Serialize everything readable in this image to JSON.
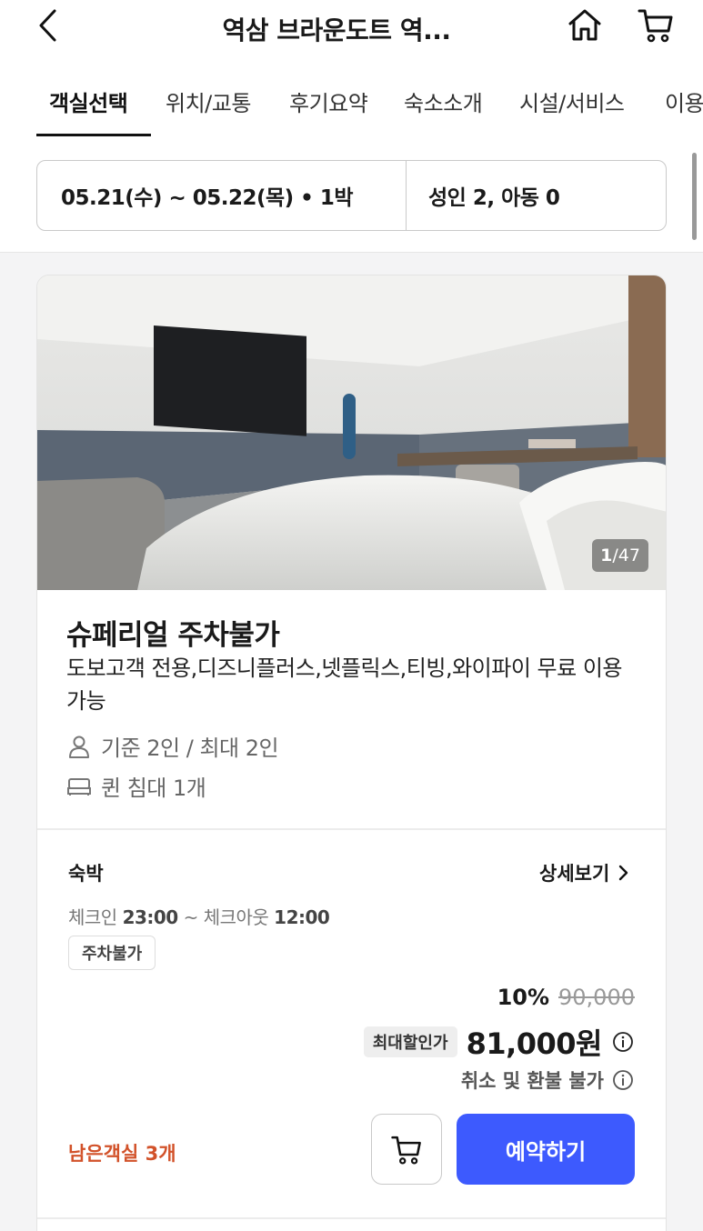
{
  "header": {
    "title": "역삼 브라운도트 역..."
  },
  "tabs": [
    "객실선택",
    "위치/교통",
    "후기요약",
    "숙소소개",
    "시설/서비스",
    "이용"
  ],
  "search": {
    "date_range": "05.21(수) ~ 05.22(목) • 1박",
    "guests": "성인 2, 아동 0"
  },
  "room": {
    "photo_index": "1",
    "photo_total": "/47",
    "name": "슈페리얼 주차불가",
    "description": "도보고객 전용,디즈니플러스,넷플릭스,티빙,와이파이 무료 이용 가능",
    "capacity": "기준 2인 / 최대 2인",
    "bed": "퀸 침대 1개"
  },
  "plan": {
    "label": "숙박",
    "detail_link": "상세보기",
    "checkin_prefix": "체크인",
    "checkin_time": "23:00",
    "checkout_prefix": "~ 체크아웃",
    "checkout_time": "12:00",
    "tag": "주차불가",
    "discount_pct": "10%",
    "original_price": "90,000",
    "max_discount_badge": "최대할인가",
    "price": "81,000원",
    "refund_policy": "취소 및 환불 불가",
    "rooms_left": "남은객실 3개",
    "reserve_button": "예약하기"
  },
  "colors": {
    "accent": "#3d5afe",
    "rooms_left": "#d2522a"
  }
}
